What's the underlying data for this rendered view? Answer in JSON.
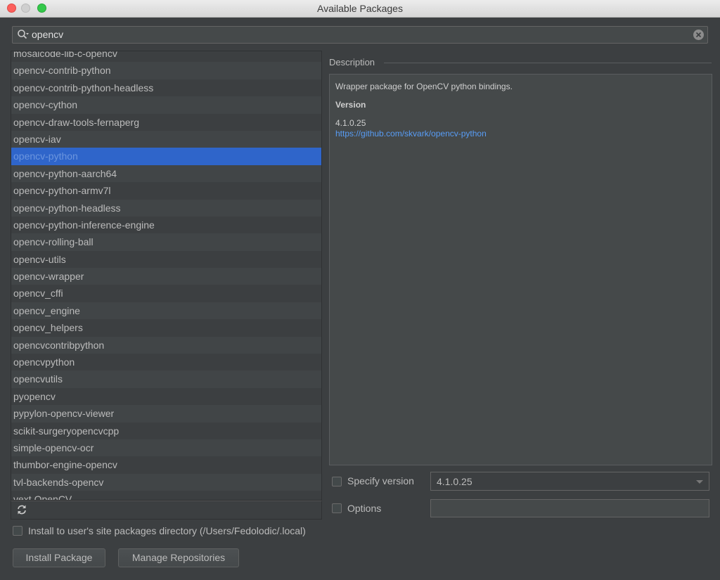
{
  "window": {
    "title": "Available Packages"
  },
  "search": {
    "value": "opencv"
  },
  "packages": [
    "mosaicode-lib-c-opencv",
    "opencv-contrib-python",
    "opencv-contrib-python-headless",
    "opencv-cython",
    "opencv-draw-tools-fernaperg",
    "opencv-iav",
    "opencv-python",
    "opencv-python-aarch64",
    "opencv-python-armv7l",
    "opencv-python-headless",
    "opencv-python-inference-engine",
    "opencv-rolling-ball",
    "opencv-utils",
    "opencv-wrapper",
    "opencv_cffi",
    "opencv_engine",
    "opencv_helpers",
    "opencvcontribpython",
    "opencvpython",
    "opencvutils",
    "pyopencv",
    "pypylon-opencv-viewer",
    "scikit-surgeryopencvcpp",
    "simple-opencv-ocr",
    "thumbor-engine-opencv",
    "tvl-backends-opencv",
    "vext.OpenCV"
  ],
  "selected_package": "opencv-python",
  "description": {
    "header": "Description",
    "text": "Wrapper package for OpenCV python bindings.",
    "version_label": "Version",
    "version": "4.1.0.25",
    "link": "https://github.com/skvark/opencv-python"
  },
  "specify_version": {
    "label": "Specify version",
    "value": "4.1.0.25"
  },
  "options": {
    "label": "Options",
    "value": ""
  },
  "install_user": {
    "label": "Install to user's site packages directory (/Users/Fedolodic/.local)"
  },
  "buttons": {
    "install": "Install Package",
    "manage": "Manage Repositories"
  }
}
